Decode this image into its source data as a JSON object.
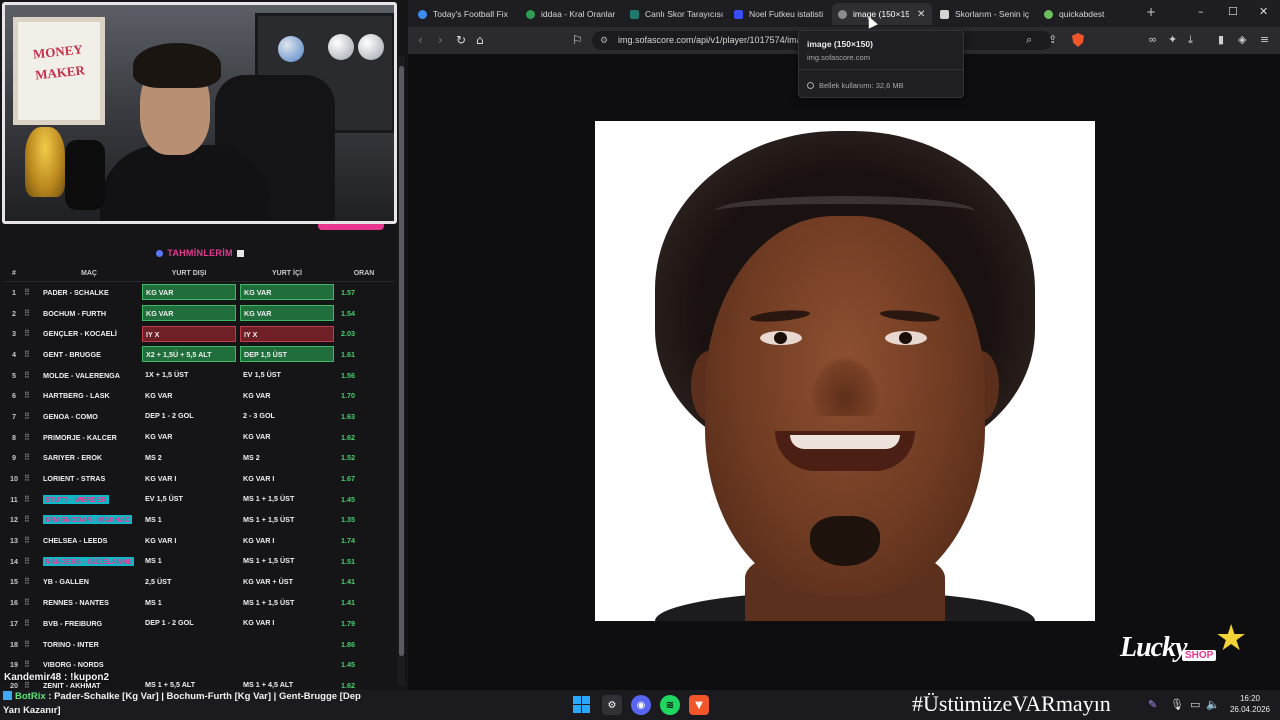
{
  "colors": {
    "accent_pink": "#e8368f",
    "success_green": "#45d06a",
    "kg_var_bg": "#1f6e3b",
    "loss_red_bg": "#6f1f26",
    "highlight_cyan": "#0fb7c7",
    "brave_orange": "#f1562b"
  },
  "webcam": {
    "poster_text": "MONEY MAKER"
  },
  "predictions": {
    "title": "TAHMİNLERİM",
    "headers": {
      "num": "#",
      "match": "MAÇ",
      "away": "YURT DIŞI",
      "home": "YURT İÇİ",
      "odds": "ORAN"
    },
    "rows": [
      {
        "num": "1",
        "match": "PADER - SCHALKE",
        "away": "KG VAR",
        "home": "KG VAR",
        "odds": "1.57",
        "status": "green",
        "hl": false
      },
      {
        "num": "2",
        "match": "BOCHUM - FURTH",
        "away": "KG VAR",
        "home": "KG VAR",
        "odds": "1.54",
        "status": "green",
        "hl": false
      },
      {
        "num": "3",
        "match": "GENÇLER - KOCAELİ",
        "away": "IY X",
        "home": "IY X",
        "odds": "2.03",
        "status": "red",
        "hl": false
      },
      {
        "num": "4",
        "match": "GENT - BRUGGE",
        "away": "X2 + 1,5Ü + 5,5 ALT",
        "home": "DEP 1,5 ÜST",
        "odds": "1.61",
        "status": "green",
        "hl": false
      },
      {
        "num": "5",
        "match": "MOLDE - VALERENGA",
        "away": "1X + 1,5 ÜST",
        "home": "EV 1,5 ÜST",
        "odds": "1.56",
        "status": "none",
        "hl": false
      },
      {
        "num": "6",
        "match": "HARTBERG - LASK",
        "away": "KG VAR",
        "home": "KG VAR",
        "odds": "1.70",
        "status": "none",
        "hl": false
      },
      {
        "num": "7",
        "match": "GENOA - COMO",
        "away": "DEP 1 - 2 GOL",
        "home": "2 - 3 GOL",
        "odds": "1.63",
        "status": "none",
        "hl": false
      },
      {
        "num": "8",
        "match": "PRIMORJE - KALCER",
        "away": "KG VAR",
        "home": "KG VAR",
        "odds": "1.62",
        "status": "none",
        "hl": false
      },
      {
        "num": "9",
        "match": "SARIYER - EROK",
        "away": "MS 2",
        "home": "MS 2",
        "odds": "1.52",
        "status": "none",
        "hl": false
      },
      {
        "num": "10",
        "match": "LORIENT - STRAS",
        "away": "KG VAR I",
        "home": "KG VAR I",
        "odds": "1.67",
        "status": "none",
        "hl": false
      },
      {
        "num": "11",
        "match": "STUTT - WERDER",
        "away": "EV 1,5 ÜST",
        "home": "MS 1 + 1,5 ÜST",
        "odds": "1.45",
        "status": "none",
        "hl": true
      },
      {
        "num": "12",
        "match": "KRASNODAR - MAKHAC",
        "away": "MS 1",
        "home": "MS 1 + 1,5 ÜST",
        "odds": "1.35",
        "status": "none",
        "hl": true
      },
      {
        "num": "13",
        "match": "CHELSEA - LEEDS",
        "away": "KG VAR I",
        "home": "KG VAR I",
        "odds": "1.74",
        "status": "none",
        "hl": false
      },
      {
        "num": "14",
        "match": "RANGERS - GÜZELANNE",
        "away": "MS 1",
        "home": "MS 1 + 1,5 ÜST",
        "odds": "1.51",
        "status": "none",
        "hl": true
      },
      {
        "num": "15",
        "match": "YB - GALLEN",
        "away": "2,5 ÜST",
        "home": "KG VAR + ÜST",
        "odds": "1.41",
        "status": "none",
        "hl": false
      },
      {
        "num": "16",
        "match": "RENNES - NANTES",
        "away": "MS 1",
        "home": "MS 1 + 1,5 ÜST",
        "odds": "1.41",
        "status": "none",
        "hl": false
      },
      {
        "num": "17",
        "match": "BVB - FREIBURG",
        "away": "DEP 1 - 2 GOL",
        "home": "KG VAR I",
        "odds": "1.79",
        "status": "none",
        "hl": false
      },
      {
        "num": "18",
        "match": "TORINO - INTER",
        "away": "",
        "home": "",
        "odds": "1.86",
        "status": "none",
        "hl": false
      },
      {
        "num": "19",
        "match": "VIBORG - NORDS",
        "away": "",
        "home": "",
        "odds": "1.45",
        "status": "none",
        "hl": false
      },
      {
        "num": "20",
        "match": "ZENIT - AKHMAT",
        "away": "MS 1 + 5,5 ALT",
        "home": "MS 1 + 4,5 ALT",
        "odds": "1.62",
        "status": "none",
        "hl": false
      }
    ]
  },
  "chat": {
    "overlay_line": "Kandemir48 : !kupon2",
    "bot_name": "BotRix",
    "bot_message": " : Pader-Schalke [Kg Var] | Bochum-Furth [Kg Var] | Gent-Brugge [Dep Yarı Kazanır]"
  },
  "browser": {
    "tabs": [
      {
        "label": "Today's Football Fix",
        "icon": "globe-icon",
        "color": "#3b8df0",
        "active": false
      },
      {
        "label": "iddaa - Kral Oranlar",
        "icon": "leaf-icon",
        "color": "#2e9d53",
        "active": false
      },
      {
        "label": "Canlı Skor Tarayıcısı",
        "icon": "bolt-icon",
        "color": "#1f7a6d",
        "active": false
      },
      {
        "label": "Noel Futkeu istatisti",
        "icon": "sofa-icon",
        "color": "#374df5",
        "active": false
      },
      {
        "label": "image (150×150)",
        "icon": "globe-icon",
        "color": "#8c8c90",
        "active": true
      },
      {
        "label": "Skorlarım - Senin iç",
        "icon": "score-icon",
        "color": "#d4d4d4",
        "active": false
      },
      {
        "label": "quickabdest",
        "icon": "leaf-icon",
        "color": "#6bbf5d",
        "active": false
      }
    ],
    "url": "img.sofascore.com/api/v1/player/1017574/image",
    "tooltip": {
      "title": "image (150×150)",
      "host": "img.sofascore.com",
      "memory": "Bellek kullanımı: 32,6 MB"
    }
  },
  "branding": {
    "logo_word": "Lucky",
    "logo_shop": "SHOP"
  },
  "taskbar": {
    "hashtag": "#ÜstümüzeVARmayın",
    "time": "16:20",
    "date": "26.04.2026"
  }
}
